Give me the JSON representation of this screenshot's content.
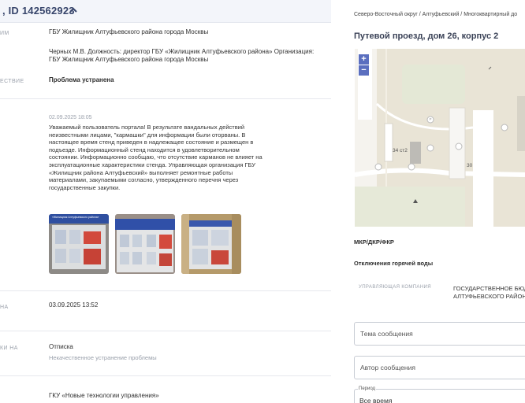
{
  "header": {
    "id_text": ", ID 142562923"
  },
  "rows": [
    {
      "label": "ИМ",
      "value": "ГБУ Жилищник Алтуфьевского района города Москвы"
    },
    {
      "label": "",
      "value": "Черных М.В. Должность: директор ГБУ «Жилищник Алтуфьевского района» Организация: ГБУ Жилищник Алтуфьевского района города Москвы"
    },
    {
      "label": "ЕСТВИЕ",
      "value": "Проблема устранена"
    }
  ],
  "comment": {
    "date": "02.09.2025 18:05",
    "text": "Уважаемый пользователь портала! В результате вандальных действий неизвестными лицами, \"кармашки\" для информации были оторваны. В настоящее время стенд приведен в надлежащее состояние и размещен в подъезде. Информационный стенд находится в удовлетворительном состоянии. Информационно сообщаю, что отсутствие карманов не влияет на эксплуатационные характеристики стенда. Управляющая организация ГБУ «Жилищник района Алтуфьевский» выполняет ремонтные работы материалами, закупаемыми согласно, утвержденного перечня через государственные закупки.",
    "photos": [
      "photo-1",
      "photo-2",
      "photo-3"
    ],
    "photo_caption": "«Жилищник Алтуфьевского района»"
  },
  "date_row": {
    "label": "НА",
    "value": "03.09.2025 13:52"
  },
  "rating_row": {
    "label": "КИ НА",
    "value": "Отписка",
    "sub": "Некачественное устранение проблемы"
  },
  "bottom_row": {
    "value": "ГКУ «Новые технологии управления»"
  },
  "right": {
    "breadcrumb": "Северо-Восточный округ / Алтуфьевский / Многоквартирный до",
    "address": "Путевой проезд, дом 26, корпус 2",
    "map": {
      "zoom_in": "+",
      "zoom_out": "−",
      "building_label": "34 ст2",
      "number_label": "30",
      "marker": "P"
    },
    "mkr": "МКР/ДКР/ФКР",
    "hot_water": "Отключения горячей воды",
    "mc_label": "УПРАВЛЯЮЩАЯ КОМПАНИЯ",
    "mc_value_1": "ГОСУДАРСТВЕННОЕ БЮД",
    "mc_value_2": "АЛТУФЬЕВСКОГО РАЙОН",
    "topic_placeholder": "Тема сообщения",
    "author_placeholder": "Автор сообщения",
    "period_legend": "Период",
    "period_value": "Все время"
  },
  "colors": {
    "header_text": "#37456b",
    "accent": "#5b6fbf",
    "muted": "#9aa0ab",
    "map_bg": "#e9e4d6"
  }
}
